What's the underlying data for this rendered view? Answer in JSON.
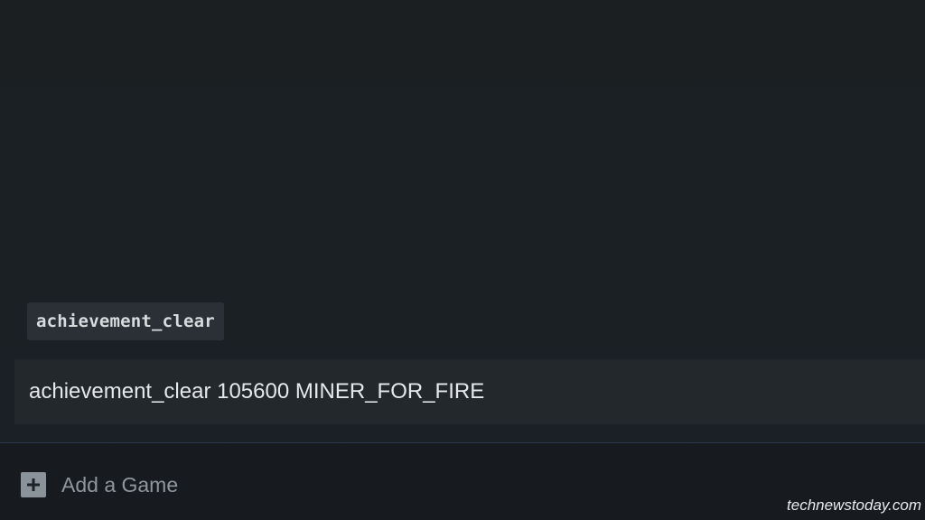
{
  "console": {
    "suggestion": "achievement_clear",
    "input_value": "achievement_clear 105600 MINER_FOR_FIRE"
  },
  "footer": {
    "add_game_label": "Add a Game",
    "add_icon": "plus-icon"
  },
  "watermark": "technewstoday.com",
  "colors": {
    "background": "#1b1f22",
    "input_background": "#23282d",
    "chip_background": "#2a3036",
    "bottom_bar": "#171b1f",
    "divider": "#2b3a4a"
  }
}
